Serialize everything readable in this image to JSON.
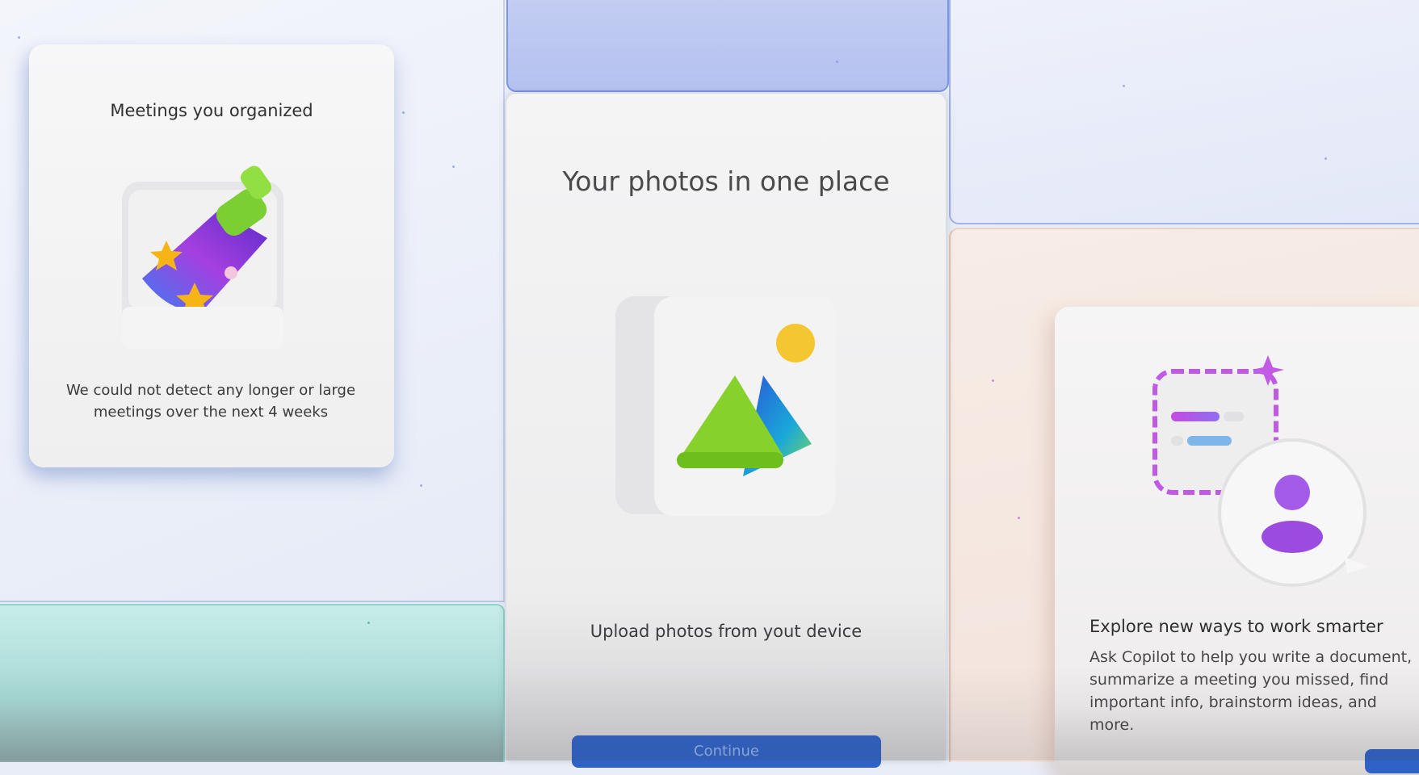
{
  "meetings_card": {
    "title": "Meetings you organized",
    "description": "We could not detect any longer or large meetings over the next 4 weeks"
  },
  "photos_card": {
    "title": "Your photos in one place",
    "subtitle": "Upload photos from yout device",
    "button_label": "Continue"
  },
  "copilot_card": {
    "heading": "Explore new ways to work smarter",
    "body": "Ask Copilot to help you write a document,\nsummarize a meeting you missed, find\nimportant info, brainstorm ideas, and more."
  },
  "icons": {
    "meetings": "flashlight-icon",
    "photos": "image-gallery-icon",
    "copilot": "copilot-chat-icon"
  },
  "colors": {
    "accent_blue": "#2f62c4",
    "tile_blue": "#b4c1ef",
    "tile_teal": "#a7d9d4",
    "tile_peach": "#f3e3dc",
    "flashlight_green": "#7ccf33",
    "mountain_green": "#86d12c",
    "sun_yellow": "#f4c632",
    "copilot_purple": "#9b4be0"
  }
}
